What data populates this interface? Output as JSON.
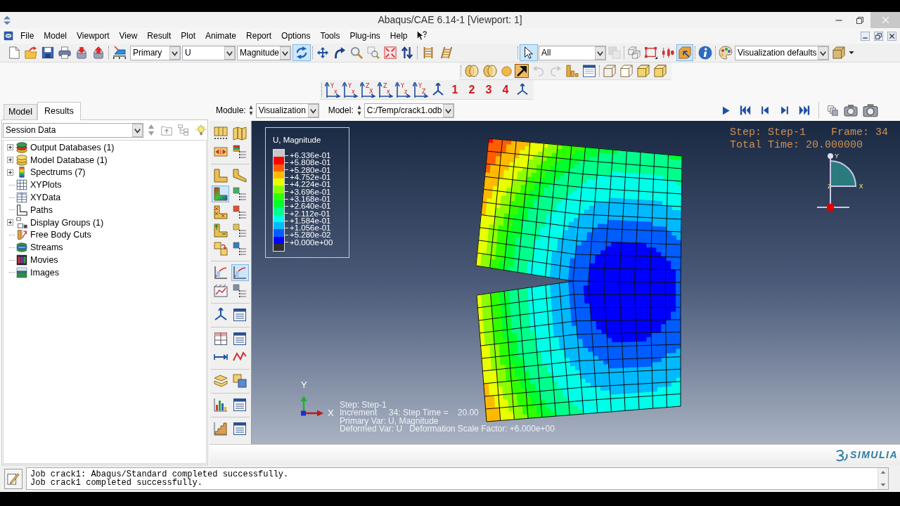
{
  "window": {
    "title": "Abaqus/CAE 6.14-1 [Viewport: 1]"
  },
  "menu": [
    "File",
    "Model",
    "Viewport",
    "View",
    "Result",
    "Plot",
    "Animate",
    "Report",
    "Options",
    "Tools",
    "Plug-ins",
    "Help"
  ],
  "toolbar": {
    "step_select": "Primary",
    "variable_select": "U",
    "invariant_select": "Magnitude",
    "sync_pressed": true,
    "select_pressed": true,
    "selection_filter": "All",
    "filter_tool_disabled": true,
    "display_tools": [
      {
        "pressed": false
      },
      {
        "pressed": false
      },
      {
        "pressed": false
      },
      {
        "pressed": true
      }
    ],
    "defaults_select": "Visualization defaults",
    "undo_disabled": true,
    "redo_disabled": true,
    "view_axes": [
      {
        "up": "Y",
        "side": "x"
      },
      {
        "up": "Y",
        "side": "x"
      },
      {
        "up": "Z",
        "side": "X"
      },
      {
        "up": "Z",
        "side": "x"
      },
      {
        "up": "Y",
        "side": "z"
      },
      {
        "up": "Y",
        "side": "Z"
      }
    ],
    "view_numbers": [
      "1",
      "2",
      "3",
      "4"
    ]
  },
  "tabs": [
    {
      "label": "Model",
      "selected": false
    },
    {
      "label": "Results",
      "selected": true
    }
  ],
  "context": {
    "module_label": "Module:",
    "module": "Visualization",
    "model_label": "Model:",
    "model": "C:/Temp/crack1.odb"
  },
  "session": {
    "select": "Session Data",
    "tree": [
      {
        "label": "Output Databases (1)",
        "kind": "branch",
        "expanded": false
      },
      {
        "label": "Model Database (1)",
        "kind": "branch",
        "expanded": false
      },
      {
        "label": "Spectrums (7)",
        "kind": "branch",
        "expanded": false
      },
      {
        "label": "XYPlots",
        "kind": "leaf"
      },
      {
        "label": "XYData",
        "kind": "leaf"
      },
      {
        "label": "Paths",
        "kind": "leaf"
      },
      {
        "label": "Display Groups (1)",
        "kind": "branch",
        "expanded": false
      },
      {
        "label": "Free Body Cuts",
        "kind": "leaf"
      },
      {
        "label": "Streams",
        "kind": "leaf"
      },
      {
        "label": "Movies",
        "kind": "leaf"
      },
      {
        "label": "Images",
        "kind": "leaf"
      }
    ]
  },
  "toolbox": [
    {
      "pressed": false
    },
    {
      "pressed": false
    },
    {
      "pressed": false
    },
    {
      "pressed": false
    },
    {
      "pressed": false
    },
    {
      "pressed": false
    },
    {
      "pressed": true
    },
    {
      "pressed": false
    },
    {
      "pressed": false
    },
    {
      "pressed": false
    },
    {
      "pressed": false
    },
    {
      "pressed": false
    },
    {
      "pressed": false
    },
    {
      "pressed": false
    },
    {
      "pressed": false
    },
    {
      "pressed": true
    },
    {
      "pressed": false
    },
    {
      "pressed": false
    },
    {
      "pressed": false
    },
    {
      "pressed": false
    },
    {
      "pressed": false
    },
    {
      "pressed": false
    },
    {
      "pressed": false
    },
    {
      "pressed": false
    },
    {
      "pressed": false
    },
    {
      "pressed": false
    },
    {
      "pressed": false
    },
    {
      "pressed": false
    },
    {
      "pressed": false
    },
    {
      "pressed": false
    }
  ],
  "viewport": {
    "legend": {
      "title": "U, Magnitude",
      "bands": [
        {
          "color": "#c8c8c8"
        },
        {
          "color": "#ff0000"
        },
        {
          "color": "#ff5d00"
        },
        {
          "color": "#ffb900"
        },
        {
          "color": "#e8ff00"
        },
        {
          "color": "#8bff00"
        },
        {
          "color": "#2eff00"
        },
        {
          "color": "#00ff2e"
        },
        {
          "color": "#00ff8b"
        },
        {
          "color": "#00ffe8"
        },
        {
          "color": "#00b9ff"
        },
        {
          "color": "#005dff"
        },
        {
          "color": "#0000ff"
        },
        {
          "color": "#2f2f2f"
        }
      ],
      "values": [
        "+6.336e-01",
        "+5.808e-01",
        "+5.280e-01",
        "+4.752e-01",
        "+4.224e-01",
        "+3.696e-01",
        "+3.168e-01",
        "+2.640e-01",
        "+2.112e-01",
        "+1.584e-01",
        "+1.056e-01",
        "+5.280e-02",
        "+0.000e+00"
      ]
    },
    "step_label": "Step: Step-1",
    "frame_label": "Frame: 34",
    "total_time": "Total Time: 20.000000",
    "indicator_labels": {
      "y": "Y",
      "z": "z",
      "x": "x"
    },
    "axis_labels": {
      "y": "Y",
      "x": "X"
    },
    "status": [
      "Step: Step-1",
      "Increment     34: Step Time =    20.00",
      "Primary Var: U, Magnitude",
      "Deformed Var: U   Deformation Scale Factor: +6.000e+00"
    ]
  },
  "brand": "SIMULIA",
  "messages": [
    "Job crack1: Abaqus/Standard completed successfully.",
    "Job crack1 completed successfully."
  ]
}
